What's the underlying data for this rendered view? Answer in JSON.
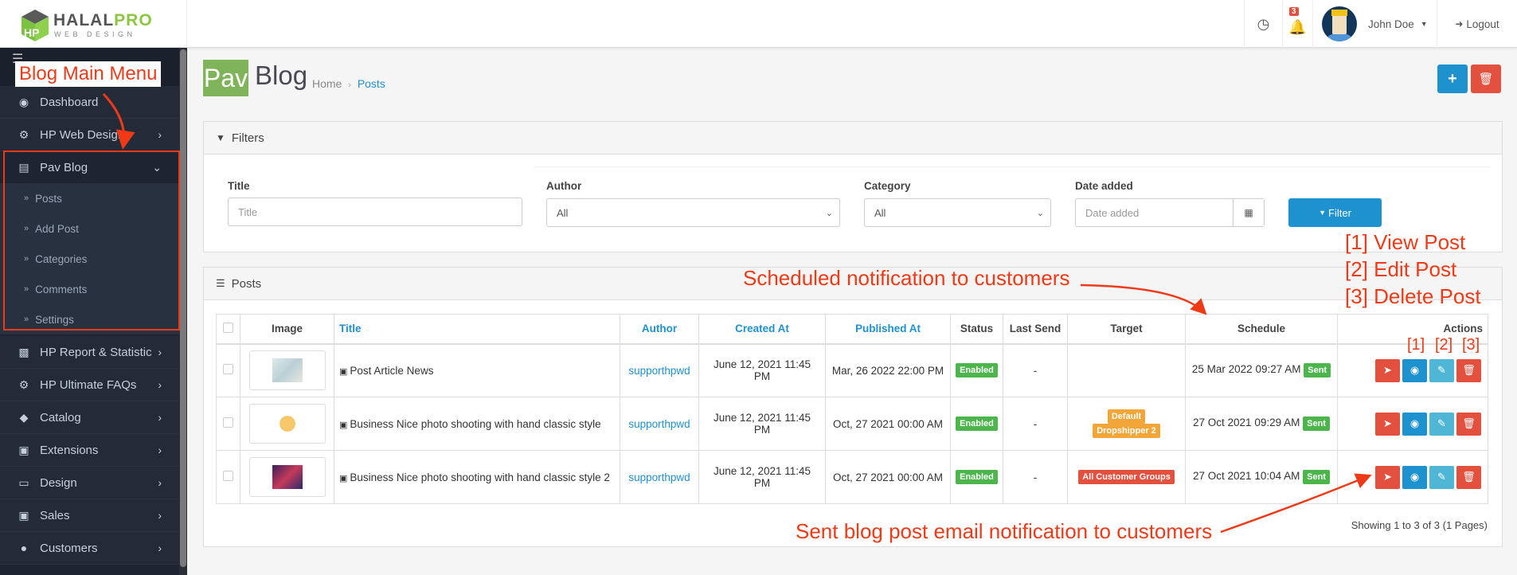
{
  "brand": {
    "name_part1": "HALAL",
    "name_part2": "PRO",
    "tagline": "WEB DESIGN"
  },
  "header": {
    "notifications_count": "3",
    "user_name": "John Doe",
    "logout": "Logout"
  },
  "sidebar": {
    "items": [
      {
        "label": "Dashboard",
        "icon": "dashboard-icon"
      },
      {
        "label": "HP Web Design",
        "icon": "cogs-icon"
      },
      {
        "label": "Pav Blog",
        "icon": "blog-icon",
        "expanded": true
      },
      {
        "label": "HP Report & Statistic",
        "icon": "bar-chart-icon"
      },
      {
        "label": "HP Ultimate FAQs",
        "icon": "cogs-icon"
      },
      {
        "label": "Catalog",
        "icon": "tags-icon"
      },
      {
        "label": "Extensions",
        "icon": "puzzle-icon"
      },
      {
        "label": "Design",
        "icon": "monitor-icon"
      },
      {
        "label": "Sales",
        "icon": "cart-icon"
      },
      {
        "label": "Customers",
        "icon": "user-icon"
      }
    ],
    "subitems": [
      "Posts",
      "Add Post",
      "Categories",
      "Comments",
      "Settings"
    ]
  },
  "page": {
    "logo_text": "Pav",
    "title": "Blog",
    "breadcrumb": [
      "Home",
      "Posts"
    ]
  },
  "filters": {
    "heading": "Filters",
    "title_label": "Title",
    "title_placeholder": "Title",
    "author_label": "Author",
    "author_value": "All",
    "category_label": "Category",
    "category_value": "All",
    "date_label": "Date added",
    "date_placeholder": "Date added",
    "filter_button": "Filter"
  },
  "posts": {
    "heading": "Posts",
    "columns": [
      "Image",
      "Title",
      "Author",
      "Created At",
      "Published At",
      "Status",
      "Last Send",
      "Target",
      "Schedule",
      "Actions"
    ],
    "rows": [
      {
        "title": "Post Article News",
        "author": "supporthpwd",
        "created": "June 12, 2021 11:45 PM",
        "published": "Mar, 26 2022 22:00 PM",
        "status": "Enabled",
        "last_send": "-",
        "targets": [],
        "schedule": "25 Mar 2022 09:27 AM",
        "schedule_status": "Sent"
      },
      {
        "title": "Business Nice photo shooting with hand classic style",
        "author": "supporthpwd",
        "created": "June 12, 2021 11:45 PM",
        "published": "Oct, 27 2021 00:00 AM",
        "status": "Enabled",
        "last_send": "-",
        "targets": [
          "Default",
          "Dropshipper 2"
        ],
        "schedule": "27 Oct 2021 09:29 AM",
        "schedule_status": "Sent"
      },
      {
        "title": "Business Nice photo shooting with hand classic style 2",
        "author": "supporthpwd",
        "created": "June 12, 2021 11:45 PM",
        "published": "Oct, 27 2021 00:00 AM",
        "status": "Enabled",
        "last_send": "-",
        "targets": [
          "All Customer Groups"
        ],
        "schedule": "27 Oct 2021 10:04 AM",
        "schedule_status": "Sent"
      }
    ],
    "pagination": "Showing 1 to 3 of 3 (1 Pages)"
  },
  "annotations": {
    "menu": "Blog Main Menu",
    "scheduled": "Scheduled notification to customers",
    "view": "[1] View Post",
    "edit": "[2] Edit Post",
    "delete": "[3] Delete Post",
    "n1": "[1]",
    "n2": "[2]",
    "n3": "[3]",
    "sent": "Sent blog post email notification to customers"
  },
  "colors": {
    "primary": "#1e91cf",
    "danger": "#e3503e",
    "info": "#4fb6d6",
    "success": "#4cb64c",
    "warning": "#f3a638",
    "sidebar": "#1e2532",
    "annotation": "#f03a17"
  }
}
